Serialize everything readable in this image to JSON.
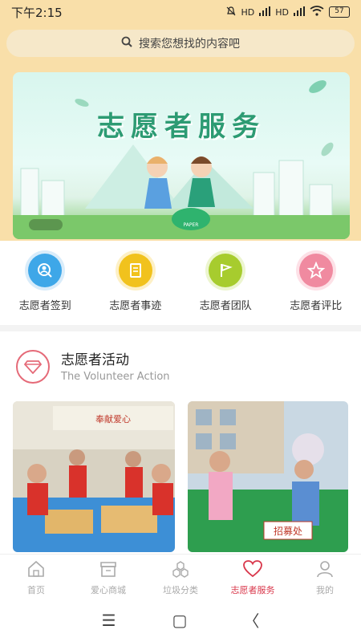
{
  "status": {
    "time": "下午2:15",
    "net1": "HD",
    "net2": "HD",
    "battery": "57"
  },
  "search": {
    "placeholder": "搜索您想找的内容吧"
  },
  "banner": {
    "title": "志愿者服务",
    "bag_text": "PAPER"
  },
  "quick": [
    {
      "label": "志愿者签到",
      "icon": "magnifier-user-icon",
      "color": "#3ea7e8"
    },
    {
      "label": "志愿者事迹",
      "icon": "notebook-icon",
      "color": "#f1c21d"
    },
    {
      "label": "志愿者团队",
      "icon": "flag-icon",
      "color": "#a7cc2e"
    },
    {
      "label": "志愿者评比",
      "icon": "star-icon",
      "color": "#f08aa0"
    }
  ],
  "section": {
    "title": "志愿者活动",
    "subtitle": "The Volunteer Action",
    "icon": "diamond-icon"
  },
  "photos": [
    {
      "sign_text": "奉献爱心"
    },
    {
      "sign_text": "招募处"
    }
  ],
  "tabs": [
    {
      "label": "首页",
      "icon": "home-icon",
      "active": false
    },
    {
      "label": "爱心商城",
      "icon": "shop-icon",
      "active": false
    },
    {
      "label": "垃圾分类",
      "icon": "hexagons-icon",
      "active": false
    },
    {
      "label": "志愿者服务",
      "icon": "heart-icon",
      "active": true
    },
    {
      "label": "我的",
      "icon": "person-icon",
      "active": false
    }
  ],
  "nav": {
    "menu": "☰",
    "home": "▢",
    "back": "〈"
  }
}
